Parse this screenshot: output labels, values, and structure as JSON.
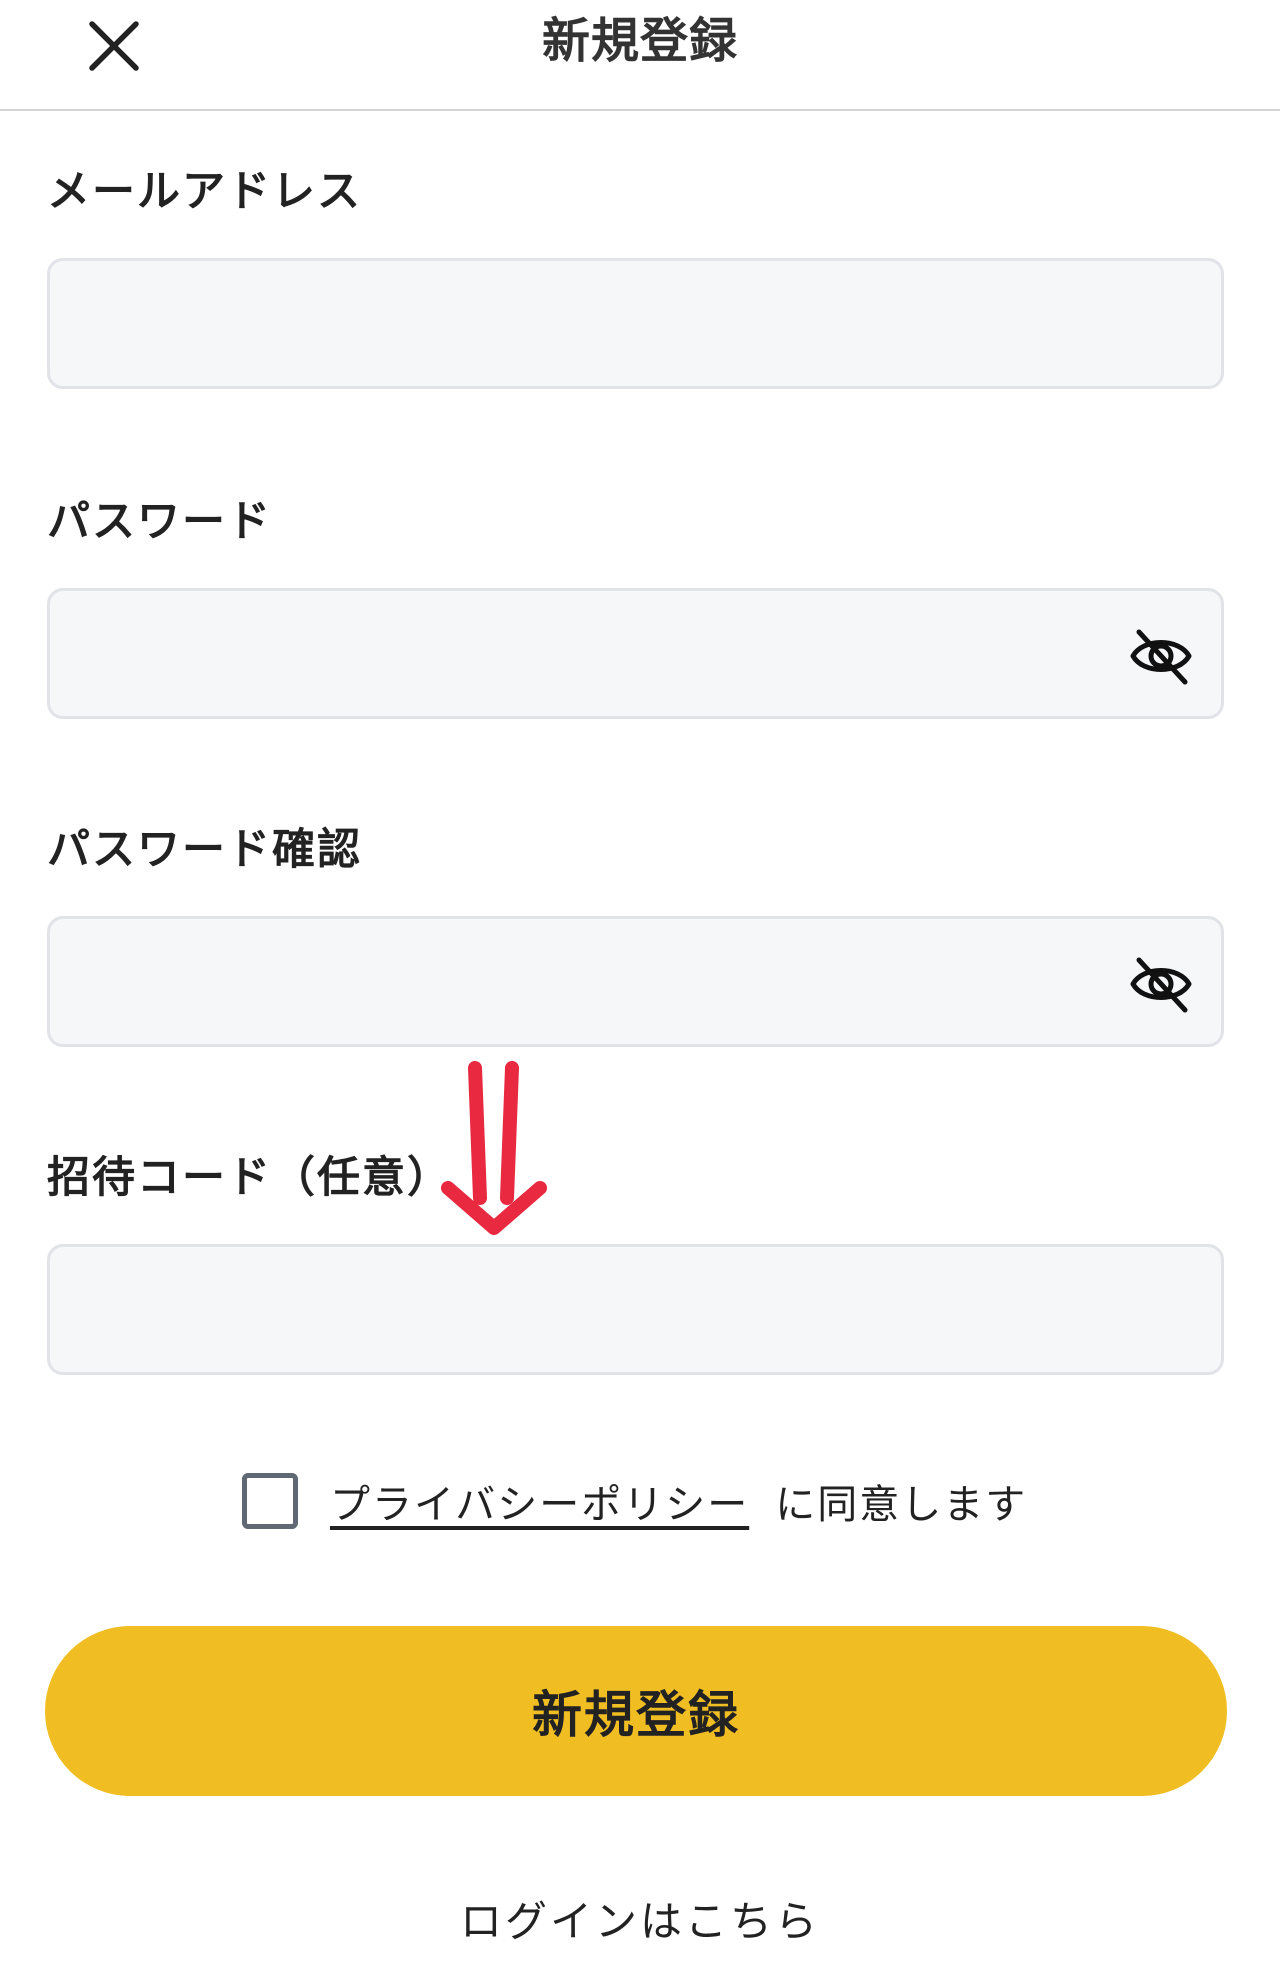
{
  "header": {
    "title": "新規登録",
    "close_icon": "close-icon"
  },
  "form": {
    "email": {
      "label": "メールアドレス",
      "value": "",
      "placeholder": ""
    },
    "password": {
      "label": "パスワード",
      "value": "",
      "placeholder": "",
      "toggle_icon": "eye-slash-icon"
    },
    "password_confirm": {
      "label": "パスワード確認",
      "value": "",
      "placeholder": "",
      "toggle_icon": "eye-slash-icon"
    },
    "invite_code": {
      "label": "招待コード（任意）",
      "value": "",
      "placeholder": ""
    }
  },
  "consent": {
    "checked": false,
    "link_text": "プライバシーポリシー",
    "suffix_text": "に同意します"
  },
  "submit_label": "新規登録",
  "login_link": "ログインはこちら",
  "annotation": {
    "icon": "red-down-arrow",
    "color": "#e8293f"
  },
  "colors": {
    "accent": "#f0be22",
    "field_bg": "#f6f7f9",
    "field_border": "#e1e3e8",
    "annotation": "#e8293f"
  }
}
